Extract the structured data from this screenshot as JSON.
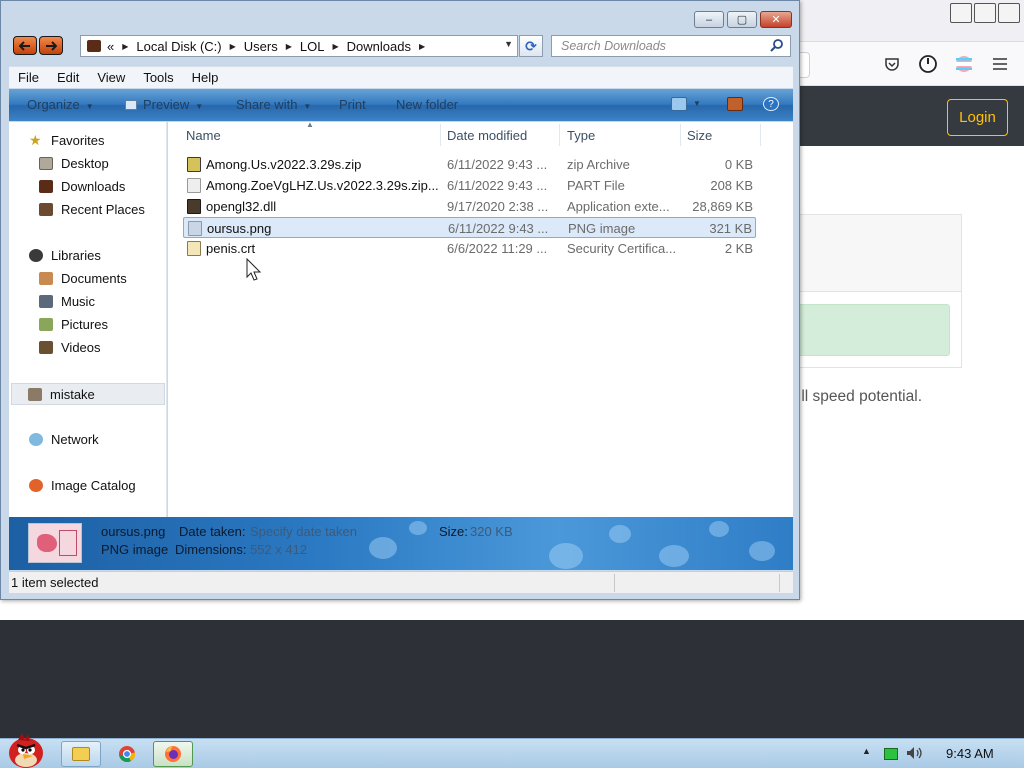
{
  "browser": {
    "login_label": "Login",
    "speed_text": "ll speed potential."
  },
  "explorer": {
    "controls": {
      "minimize": "–",
      "maximize": "▢",
      "close": "✕"
    },
    "address": {
      "overflow": "«",
      "crumbs": [
        "Local Disk (C:)",
        "Users",
        "LOL",
        "Downloads"
      ]
    },
    "search_placeholder": "Search Downloads",
    "menu": [
      "File",
      "Edit",
      "View",
      "Tools",
      "Help"
    ],
    "commands": {
      "organize": "Organize",
      "preview": "Preview",
      "share_with": "Share with",
      "print": "Print",
      "new_folder": "New folder"
    },
    "nav": {
      "favorites": "Favorites",
      "desktop": "Desktop",
      "downloads": "Downloads",
      "recent_places": "Recent Places",
      "libraries": "Libraries",
      "documents": "Documents",
      "music": "Music",
      "pictures": "Pictures",
      "videos": "Videos",
      "mistake": "mistake",
      "network": "Network",
      "image_catalog": "Image Catalog"
    },
    "columns": {
      "name": "Name",
      "date": "Date modified",
      "type": "Type",
      "size": "Size"
    },
    "files": [
      {
        "name": "Among.Us.v2022.3.29s.zip",
        "date": "6/11/2022 9:43 ...",
        "type": "zip Archive",
        "size": "0 KB",
        "icon": "zip-icon",
        "color": "#d6c25a"
      },
      {
        "name": "Among.ZoeVgLHZ.Us.v2022.3.29s.zip....",
        "date": "6/11/2022 9:43 ...",
        "type": "PART File",
        "size": "208 KB",
        "icon": "file-icon",
        "color": "#e8e8e8"
      },
      {
        "name": "opengl32.dll",
        "date": "9/17/2020 2:38 ...",
        "type": "Application exte...",
        "size": "28,869 KB",
        "icon": "dll-icon",
        "color": "#4a3a2a"
      },
      {
        "name": "oursus.png",
        "date": "6/11/2022 9:43 ...",
        "type": "PNG image",
        "size": "321 KB",
        "icon": "image-icon",
        "color": "#c9d6e6"
      },
      {
        "name": "penis.crt",
        "date": "6/6/2022 11:29 ...",
        "type": "Security Certifica...",
        "size": "2 KB",
        "icon": "certificate-icon",
        "color": "#f3e6b8"
      }
    ],
    "details": {
      "filename": "oursus.png",
      "filetype": "PNG image",
      "date_taken_label": "Date taken:",
      "date_taken_value": "Specify date taken",
      "dimensions_label": "Dimensions:",
      "dimensions_value": "552 x 412",
      "size_label": "Size:",
      "size_value": "320 KB"
    },
    "status": "1 item selected"
  },
  "taskbar": {
    "clock": "9:43 AM"
  }
}
